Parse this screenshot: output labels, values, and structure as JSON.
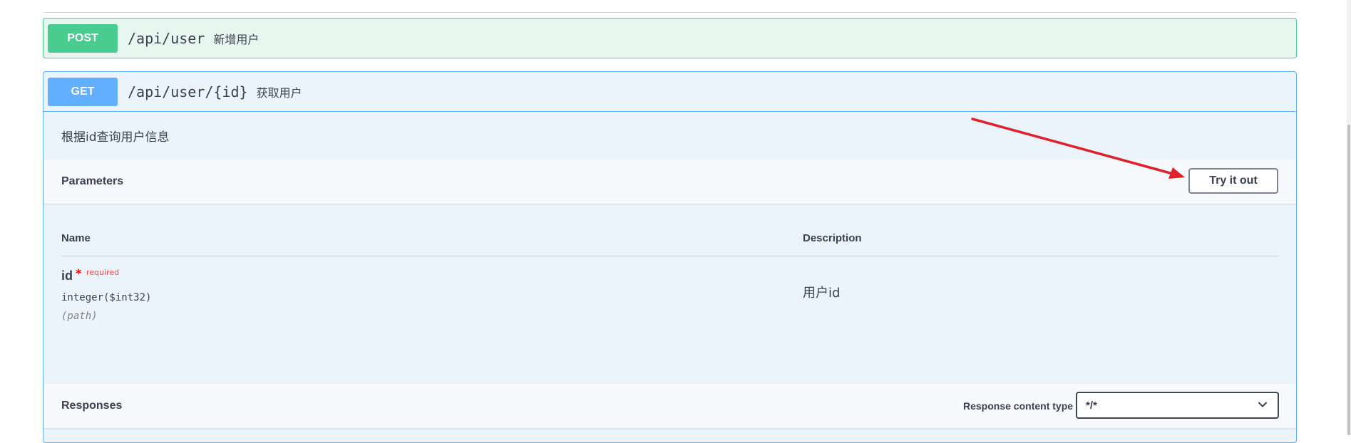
{
  "endpoints": {
    "post": {
      "method": "POST",
      "path": "/api/user",
      "summary": "新增用户"
    },
    "get": {
      "method": "GET",
      "path": "/api/user/{id}",
      "summary": "获取用户",
      "description": "根据id查询用户信息",
      "parameters": {
        "title": "Parameters",
        "try_button": "Try it out",
        "columns": {
          "name": "Name",
          "description": "Description"
        },
        "items": [
          {
            "name": "id",
            "required_mark": "*",
            "required_label": "required",
            "type": "integer($int32)",
            "in": "(path)",
            "description": "用户id"
          }
        ]
      },
      "responses": {
        "title": "Responses",
        "content_type_label": "Response content type",
        "content_type_value": "*/*"
      }
    }
  },
  "colors": {
    "post": "#49cc90",
    "get": "#61affe",
    "annotation_arrow": "#e0202a"
  },
  "icons": [
    "chevron-down-icon"
  ]
}
